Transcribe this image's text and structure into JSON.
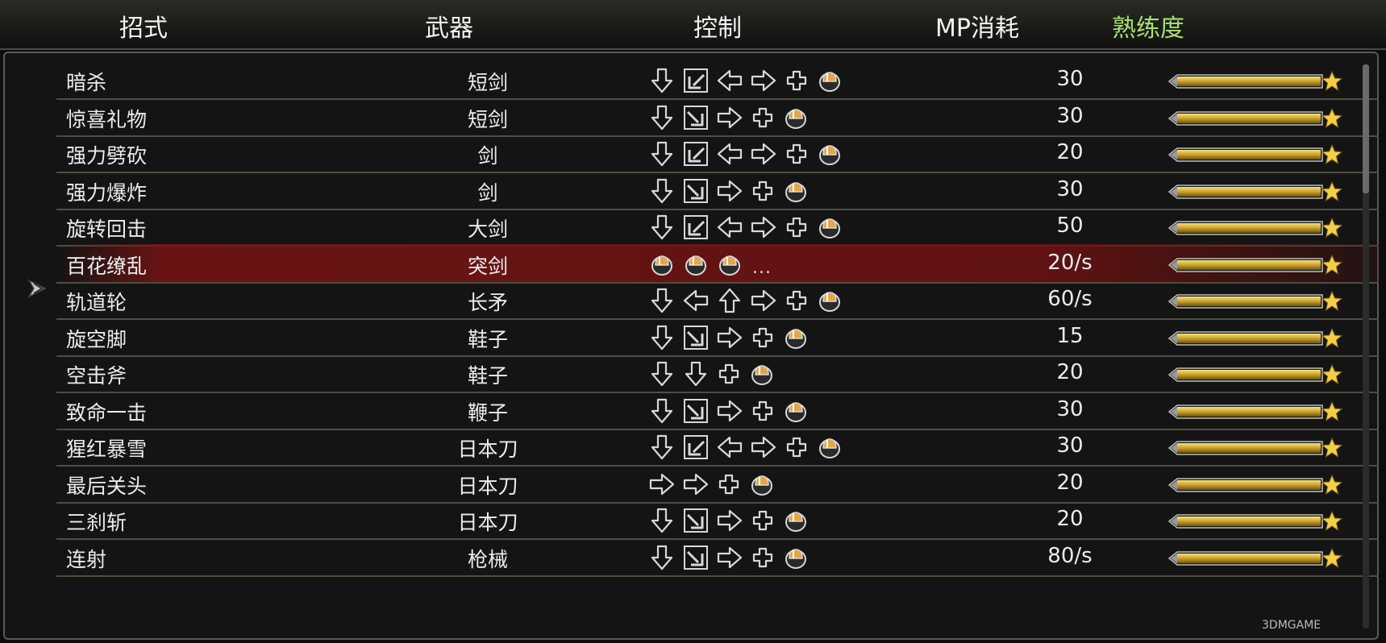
{
  "headers": {
    "name": "招式",
    "weapon": "武器",
    "control": "控制",
    "mp": "MP消耗",
    "proficiency": "熟练度"
  },
  "proficiency_color": "#a8e070",
  "selected_row": 5,
  "rows": [
    {
      "name": "暗杀",
      "weapon": "短剑",
      "mp": "30",
      "controls": [
        "down",
        "downleft",
        "left",
        "right",
        "plus",
        "button"
      ],
      "proficiency": 1.0
    },
    {
      "name": "惊喜礼物",
      "weapon": "短剑",
      "mp": "30",
      "controls": [
        "down",
        "downright",
        "right",
        "plus",
        "button"
      ],
      "proficiency": 1.0
    },
    {
      "name": "强力劈砍",
      "weapon": "剑",
      "mp": "20",
      "controls": [
        "down",
        "downleft",
        "left",
        "right",
        "plus",
        "button"
      ],
      "proficiency": 1.0
    },
    {
      "name": "强力爆炸",
      "weapon": "剑",
      "mp": "30",
      "controls": [
        "down",
        "downright",
        "right",
        "plus",
        "button"
      ],
      "proficiency": 1.0
    },
    {
      "name": "旋转回击",
      "weapon": "大剑",
      "mp": "50",
      "controls": [
        "down",
        "downleft",
        "left",
        "right",
        "plus",
        "button"
      ],
      "proficiency": 1.0
    },
    {
      "name": "百花缭乱",
      "weapon": "突剑",
      "mp": "20/s",
      "controls": [
        "button",
        "button",
        "button",
        "ellipsis"
      ],
      "proficiency": 1.0
    },
    {
      "name": "轨道轮",
      "weapon": "长矛",
      "mp": "60/s",
      "controls": [
        "down",
        "left",
        "up",
        "right",
        "plus",
        "button"
      ],
      "proficiency": 1.0
    },
    {
      "name": "旋空脚",
      "weapon": "鞋子",
      "mp": "15",
      "controls": [
        "down",
        "downright",
        "right",
        "plus",
        "button"
      ],
      "proficiency": 1.0
    },
    {
      "name": "空击斧",
      "weapon": "鞋子",
      "mp": "20",
      "controls": [
        "down",
        "down",
        "plus",
        "button"
      ],
      "proficiency": 1.0
    },
    {
      "name": "致命一击",
      "weapon": "鞭子",
      "mp": "30",
      "controls": [
        "down",
        "downright",
        "right",
        "plus",
        "button"
      ],
      "proficiency": 1.0
    },
    {
      "name": "猩红暴雪",
      "weapon": "日本刀",
      "mp": "30",
      "controls": [
        "down",
        "downleft",
        "left",
        "right",
        "plus",
        "button"
      ],
      "proficiency": 1.0
    },
    {
      "name": "最后关头",
      "weapon": "日本刀",
      "mp": "20",
      "controls": [
        "right",
        "right",
        "plus",
        "button"
      ],
      "proficiency": 1.0
    },
    {
      "name": "三刹斩",
      "weapon": "日本刀",
      "mp": "20",
      "controls": [
        "down",
        "downright",
        "right",
        "plus",
        "button"
      ],
      "proficiency": 1.0
    },
    {
      "name": "连射",
      "weapon": "枪械",
      "mp": "80/s",
      "controls": [
        "down",
        "downright",
        "right",
        "plus",
        "button"
      ],
      "proficiency": 1.0
    }
  ],
  "ellipsis_text": "...",
  "watermark": "3DMGAME"
}
